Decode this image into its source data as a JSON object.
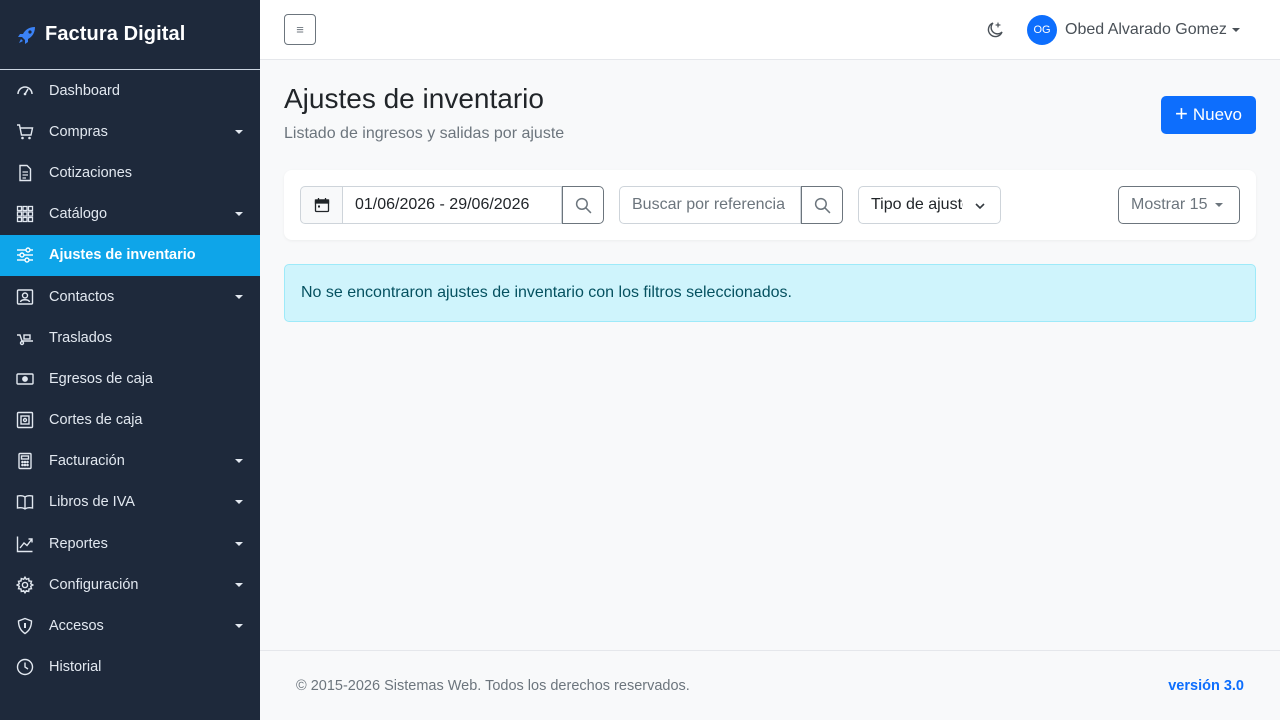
{
  "brand": {
    "name": "Factura Digital",
    "icon": "rocket-icon"
  },
  "sidebar": {
    "items": [
      {
        "label": "Dashboard",
        "icon": "speedometer-icon",
        "has_submenu": false
      },
      {
        "label": "Compras",
        "icon": "cart-icon",
        "has_submenu": true
      },
      {
        "label": "Cotizaciones",
        "icon": "document-icon",
        "has_submenu": false
      },
      {
        "label": "Catálogo",
        "icon": "grid-icon",
        "has_submenu": true
      },
      {
        "label": "Ajustes de inventario",
        "icon": "sliders-icon",
        "has_submenu": false,
        "active": true
      },
      {
        "label": "Contactos",
        "icon": "contact-card-icon",
        "has_submenu": true
      },
      {
        "label": "Traslados",
        "icon": "dolly-icon",
        "has_submenu": false
      },
      {
        "label": "Egresos de caja",
        "icon": "cash-icon",
        "has_submenu": false
      },
      {
        "label": "Cortes de caja",
        "icon": "safe-icon",
        "has_submenu": false
      },
      {
        "label": "Facturación",
        "icon": "calculator-icon",
        "has_submenu": true
      },
      {
        "label": "Libros de IVA",
        "icon": "book-icon",
        "has_submenu": true
      },
      {
        "label": "Reportes",
        "icon": "graph-up-icon",
        "has_submenu": true
      },
      {
        "label": "Configuración",
        "icon": "gear-icon",
        "has_submenu": true
      },
      {
        "label": "Accesos",
        "icon": "shield-icon",
        "has_submenu": true
      },
      {
        "label": "Historial",
        "icon": "clock-icon",
        "has_submenu": false
      }
    ]
  },
  "topbar": {
    "toggle_icon": "≡",
    "theme_icon": "moon-stars-icon",
    "user": {
      "initials": "OG",
      "name": "Obed Alvarado Gomez"
    }
  },
  "main": {
    "title": "Ajustes de inventario",
    "subtitle": "Listado de ingresos y salidas por ajuste",
    "new_button": {
      "plus": "+",
      "label": "Nuevo"
    }
  },
  "filters": {
    "date_range": "01/06/2026 - 29/06/2026",
    "search_placeholder": "Buscar por referencia",
    "tipo_label": "Tipo de ajuste",
    "mostrar_label": "Mostrar 15"
  },
  "alert": {
    "message": "No se encontraron ajustes de inventario con los filtros seleccionados."
  },
  "footer": {
    "copyright": "© 2015-2026 Sistemas Web. Todos los derechos reservados.",
    "version": "versión 3.0"
  },
  "colors": {
    "sidebar_bg": "#1e293b",
    "active_item": "#0ea5e9",
    "primary": "#0d6efd",
    "alert_bg": "#cff4fc",
    "alert_text": "#055160"
  }
}
